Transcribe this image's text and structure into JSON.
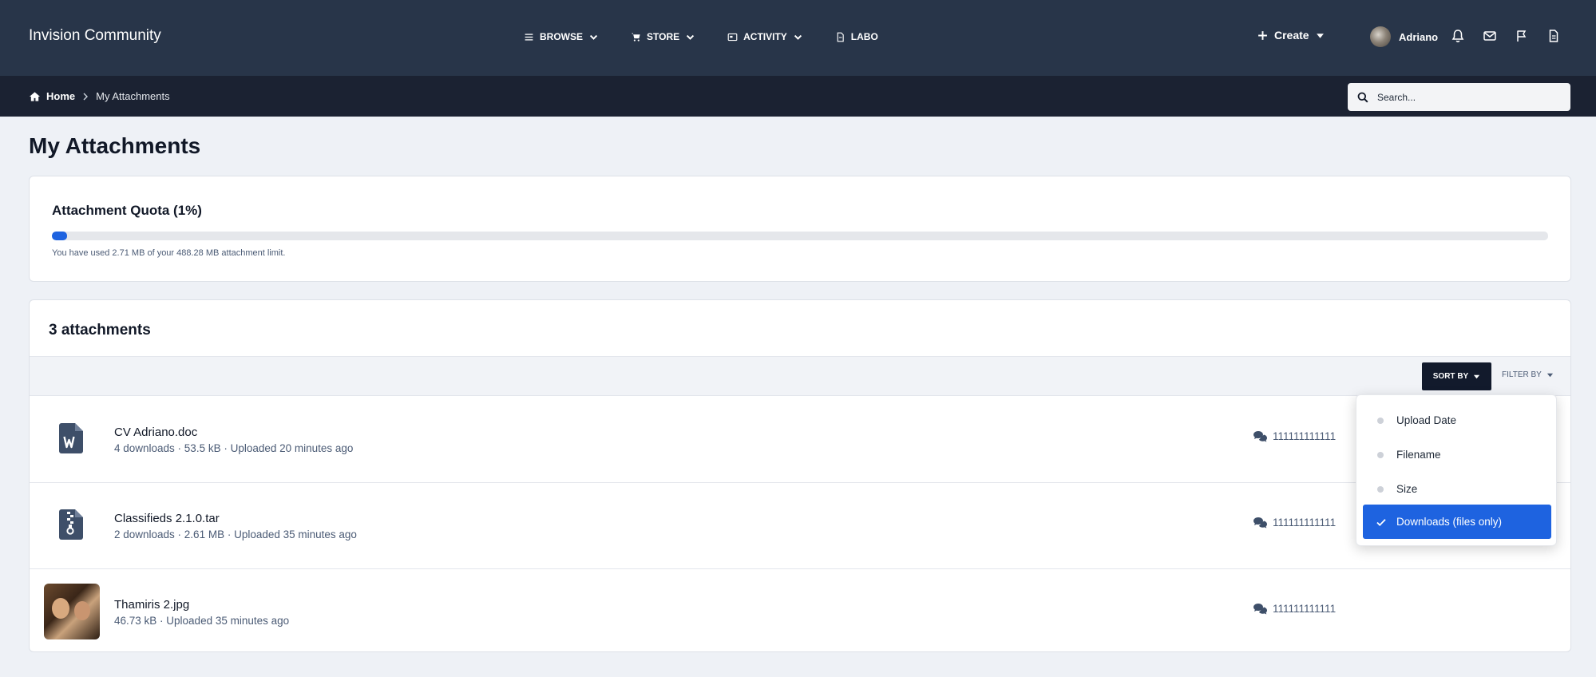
{
  "header": {
    "brand": "Invision Community",
    "nav": [
      {
        "label": "BROWSE",
        "icon": "menu-icon",
        "has_caret": true
      },
      {
        "label": "STORE",
        "icon": "cart-icon",
        "has_caret": true
      },
      {
        "label": "ACTIVITY",
        "icon": "activity-icon",
        "has_caret": true
      },
      {
        "label": "LABO",
        "icon": "document-icon",
        "has_caret": false
      }
    ],
    "create_label": "Create",
    "user_name": "Adriano",
    "icons": [
      "bell-icon",
      "envelope-icon",
      "flag-icon",
      "document-icon"
    ]
  },
  "breadcrumb": {
    "home": "Home",
    "current": "My Attachments"
  },
  "search": {
    "placeholder": "Search..."
  },
  "page": {
    "title": "My Attachments"
  },
  "quota": {
    "title": "Attachment Quota (1%)",
    "percent": 1,
    "text": "You have used 2.71 MB of your 488.28 MB attachment limit."
  },
  "attachments": {
    "heading": "3 attachments",
    "sort_label": "SORT BY",
    "filter_label": "FILTER BY",
    "items": [
      {
        "name": "CV Adriano.doc",
        "meta": "4 downloads · 53.5 kB · Uploaded 20 minutes ago",
        "uses": "111111111111",
        "icon": "word-file-icon"
      },
      {
        "name": "Classifieds 2.1.0.tar",
        "meta": "2 downloads · 2.61 MB · Uploaded 35 minutes ago",
        "uses": "111111111111",
        "icon": "archive-file-icon"
      },
      {
        "name": "Thamiris 2.jpg",
        "meta": "46.73 kB · Uploaded 35 minutes ago",
        "uses": "111111111111",
        "icon": "image-thumbnail"
      }
    ]
  },
  "sort_menu": {
    "options": [
      "Upload Date",
      "Filename",
      "Size",
      "Downloads (files only)"
    ],
    "selected": "Downloads (files only)"
  },
  "colors": {
    "header_bg": "#283549",
    "breadcrumb_bg": "#1b2232",
    "accent": "#1e63e0",
    "page_bg": "#eef1f6"
  }
}
